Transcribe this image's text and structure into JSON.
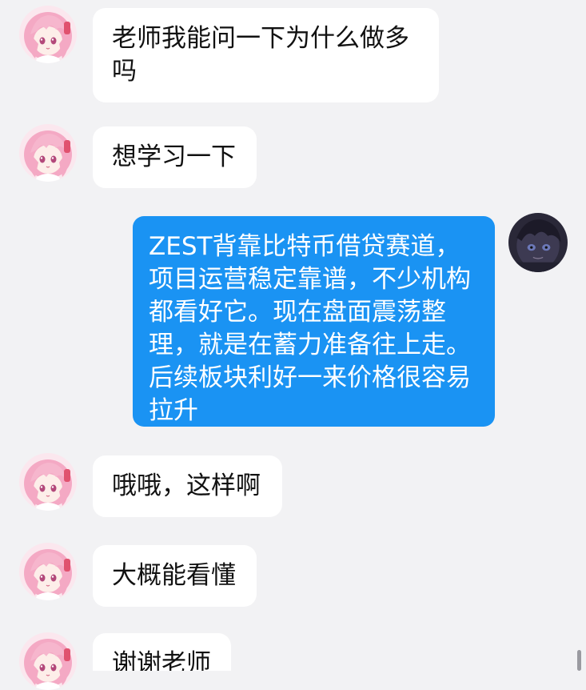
{
  "messages": [
    {
      "side": "incoming",
      "text": "老师我能问一下为什么做多吗",
      "avatar": "pink-hair-anime-girl-avatar"
    },
    {
      "side": "incoming",
      "text": "想学习一下",
      "avatar": "pink-hair-anime-girl-avatar"
    },
    {
      "side": "outgoing",
      "text": "ZEST背靠比特币借贷赛道，项目运营稳定靠谱，不少机构都看好它。现在盘面震荡整理，就是在蓄力准备往上走。后续板块利好一来价格很容易拉升",
      "avatar": "dark-anime-character-avatar"
    },
    {
      "side": "incoming",
      "text": "哦哦，这样啊",
      "avatar": "pink-hair-anime-girl-avatar"
    },
    {
      "side": "incoming",
      "text": "大概能看懂",
      "avatar": "pink-hair-anime-girl-avatar"
    },
    {
      "side": "incoming",
      "text": "谢谢老师",
      "avatar": "pink-hair-anime-girl-avatar"
    }
  ],
  "colors": {
    "background": "#f2f2f4",
    "incoming_bubble": "#ffffff",
    "outgoing_bubble": "#1a93f3"
  }
}
